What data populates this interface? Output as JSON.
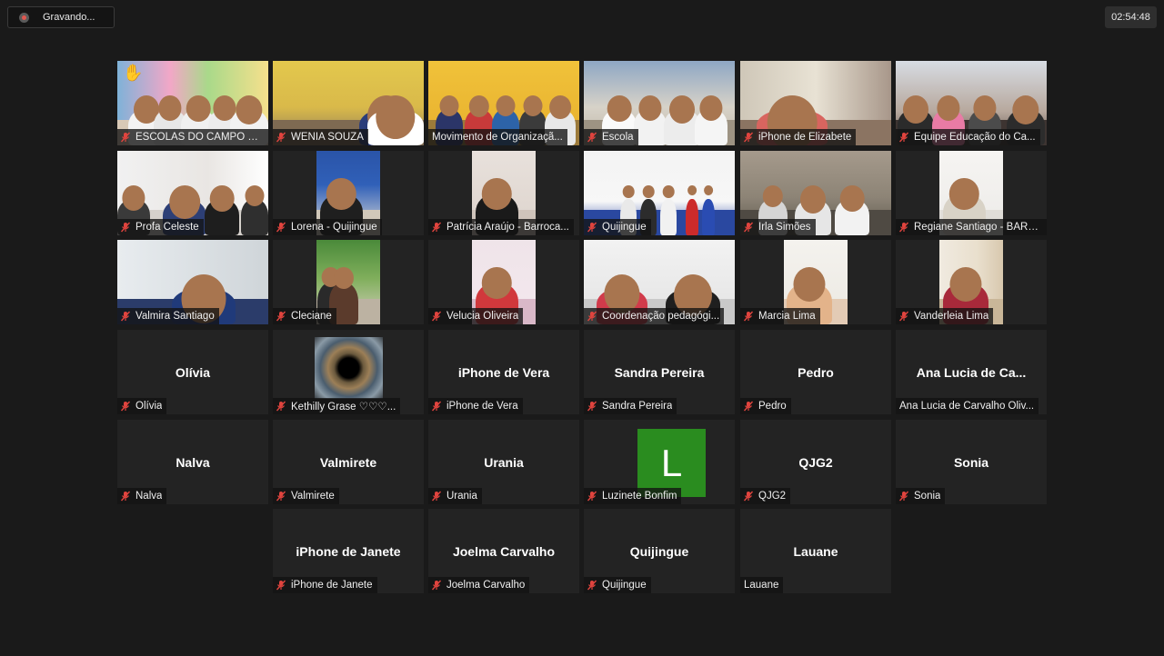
{
  "recording": {
    "label": "Gravando..."
  },
  "timer": {
    "value": "02:54:48"
  },
  "colors": {
    "accent_active": "#c9dd53",
    "mute_red": "#e0443e",
    "avatar_green": "#2a8c1f"
  },
  "participants": [
    {
      "label": "ESCOLAS DO CAMPO N...",
      "muted": true,
      "video": true,
      "active": false,
      "scene": "stage-kids",
      "raised_hand": true
    },
    {
      "label": "WÊNIA SOUZA",
      "muted": true,
      "video": true,
      "scene": "classroom-yellow"
    },
    {
      "label": "Movimento de Organizaçã...",
      "muted": false,
      "video": true,
      "active": true,
      "scene": "yellow-wall-kids"
    },
    {
      "label": "Escola",
      "muted": true,
      "video": true,
      "scene": "classroom-kids"
    },
    {
      "label": "iPhone de Elizabete",
      "muted": true,
      "video": true,
      "scene": "woman-closeup"
    },
    {
      "label": "Equipe Educação do Ca...",
      "muted": true,
      "video": true,
      "scene": "group-masks"
    },
    {
      "label": "Profa Celeste",
      "muted": true,
      "video": true,
      "scene": "women-masks"
    },
    {
      "label": "Lorena - Quijingue",
      "muted": true,
      "video": true,
      "scene": "woman-banner",
      "narrow": true
    },
    {
      "label": "Patrícia Araújo - Barroca...",
      "muted": true,
      "video": true,
      "scene": "woman-portrait",
      "narrow": true
    },
    {
      "label": "Quijingue",
      "muted": true,
      "video": true,
      "scene": "flags-stage"
    },
    {
      "label": "Irla Simões",
      "muted": true,
      "video": true,
      "scene": "classroom-dim"
    },
    {
      "label": "Regiane Santiago - BARR...",
      "muted": true,
      "video": true,
      "scene": "woman-portrait-light",
      "narrow": true
    },
    {
      "label": "Valmira Santiago",
      "muted": true,
      "video": true,
      "scene": "woman-glasses"
    },
    {
      "label": "Cleciane",
      "muted": true,
      "video": true,
      "scene": "two-women-tree",
      "narrow": true
    },
    {
      "label": "Velucia Oliveira",
      "muted": true,
      "video": true,
      "scene": "woman-pink",
      "narrow": true
    },
    {
      "label": "Coordenação pedagógi...",
      "muted": true,
      "video": true,
      "scene": "two-women-masks"
    },
    {
      "label": "Marcia Lima",
      "muted": true,
      "video": true,
      "scene": "woman-floral",
      "narrow": true
    },
    {
      "label": "Vanderleia Lima",
      "muted": true,
      "video": true,
      "scene": "woman-door",
      "narrow": true
    },
    {
      "label": "Olívia",
      "name": "Olívia",
      "muted": true,
      "video": false
    },
    {
      "label": "Kethilly Grase ♡♡♡...",
      "muted": true,
      "video": false,
      "profile_image": "eye-iris"
    },
    {
      "label": "iPhone de Vera",
      "name": "iPhone de Vera",
      "muted": true,
      "video": false
    },
    {
      "label": "Sandra Pereira",
      "name": "Sandra Pereira",
      "muted": true,
      "video": false
    },
    {
      "label": "Pedro",
      "name": "Pedro",
      "muted": true,
      "video": false
    },
    {
      "label": "Ana Lucia de Carvalho Oliv...",
      "name": "Ana Lucia de Ca...",
      "muted": false,
      "video": false
    },
    {
      "label": "Nalva",
      "name": "Nalva",
      "muted": true,
      "video": false
    },
    {
      "label": "Valmirete",
      "name": "Valmirete",
      "muted": true,
      "video": false
    },
    {
      "label": "Urania",
      "name": "Urania",
      "muted": true,
      "video": false
    },
    {
      "label": "Luzinete Bonfim",
      "avatar_letter": "L",
      "muted": true,
      "video": false
    },
    {
      "label": "QJG2",
      "name": "QJG2",
      "muted": true,
      "video": false
    },
    {
      "label": "Sonia",
      "name": "Sonia",
      "muted": true,
      "video": false
    },
    {
      "label": "iPhone de Janete",
      "name": "iPhone de Janete",
      "muted": true,
      "video": false
    },
    {
      "label": "Joelma Carvalho",
      "name": "Joelma Carvalho",
      "muted": true,
      "video": false
    },
    {
      "label": "Quijingue",
      "name": "Quijingue",
      "muted": true,
      "video": false
    },
    {
      "label": "Lauane",
      "name": "Lauane",
      "muted": false,
      "video": false
    }
  ]
}
